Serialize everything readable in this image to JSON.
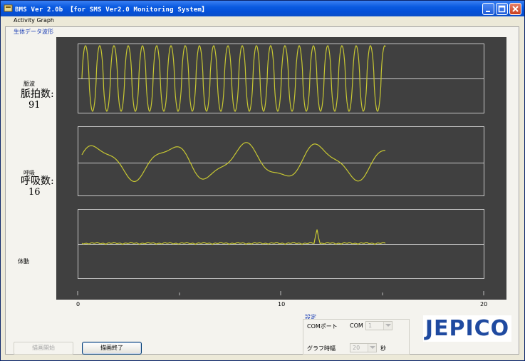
{
  "window": {
    "title": "BMS Ver 2.0b  【for SMS Ver2.0 Monitoring System】"
  },
  "menu": {
    "activity_graph": "Activity Graph"
  },
  "tab": {
    "label": "生体データ波形"
  },
  "pulse": {
    "caption": "脈波",
    "label": "脈拍数:",
    "value": "91"
  },
  "respiration": {
    "caption": "呼吸",
    "label": "呼吸数:",
    "value": "16"
  },
  "activity": {
    "caption": "体動"
  },
  "x_axis": {
    "ticks": [
      "0",
      "10",
      "20"
    ]
  },
  "settings": {
    "caption": "設定",
    "com_port_label": "COMポート",
    "com_prefix": "COM",
    "com_value": "1",
    "graph_time_label": "グラフ時幅",
    "graph_time_value": "20",
    "graph_time_unit": "秒"
  },
  "logo": {
    "text": "JEPICO"
  },
  "buttons": {
    "start": "描画開始",
    "stop": "描画終了"
  },
  "colors": {
    "trace": "#C8C832",
    "plot_bg": "#404040",
    "grid": "#C8C8C8",
    "title_bar": "#0A5AE0",
    "logo_blue": "#1F4AA0"
  }
}
